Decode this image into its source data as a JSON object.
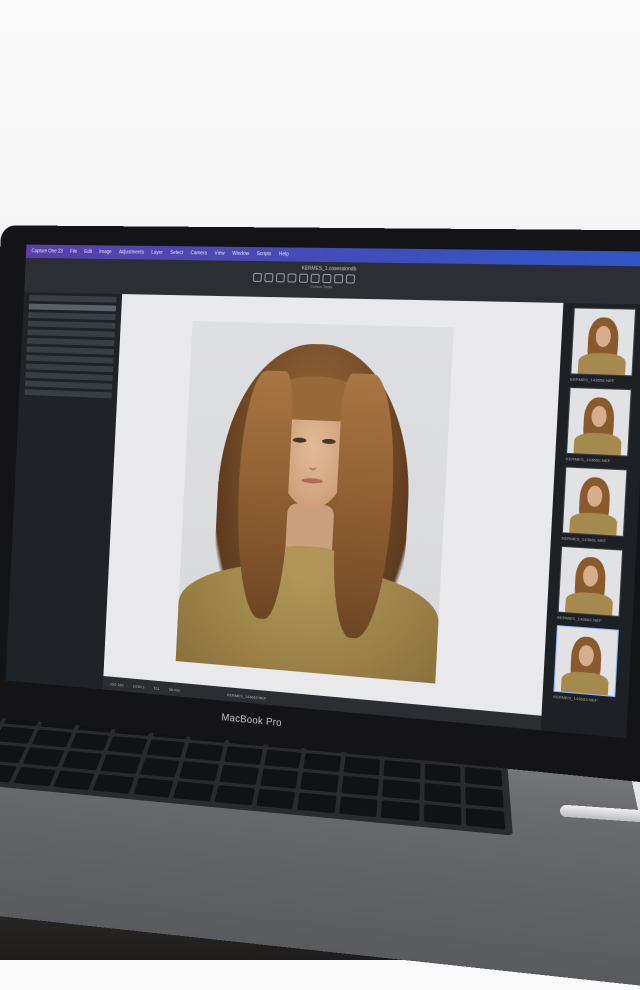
{
  "menubar": {
    "app_name": "Capture One 23",
    "items": [
      "File",
      "Edit",
      "Image",
      "Adjustments",
      "Layer",
      "Select",
      "Camera",
      "View",
      "Window",
      "Scripts",
      "Help"
    ]
  },
  "toolbar": {
    "document_title": "KERMES_1.cosessiondb",
    "tools_caption": "Cursor Tools"
  },
  "status_bar": {
    "iso": "ISO 160",
    "shutter": "1/200 s",
    "aperture": "f/11",
    "focal": "58 mm",
    "filename": "KERMES_143663.NEF"
  },
  "filmstrip": {
    "labels": [
      "KERMES_143658.NEF",
      "KERMES_143660.NEF",
      "KERMES_143661.NEF",
      "KERMES_143662.NEF",
      "KERMES_143663.NEF"
    ]
  },
  "bezel": {
    "model": "MacBook Pro"
  },
  "colors": {
    "menubar_gradient_start": "#5a3fa8",
    "menubar_gradient_end": "#2f57c9",
    "sweater": "#9c8348",
    "hair": "#8a5a2f"
  }
}
